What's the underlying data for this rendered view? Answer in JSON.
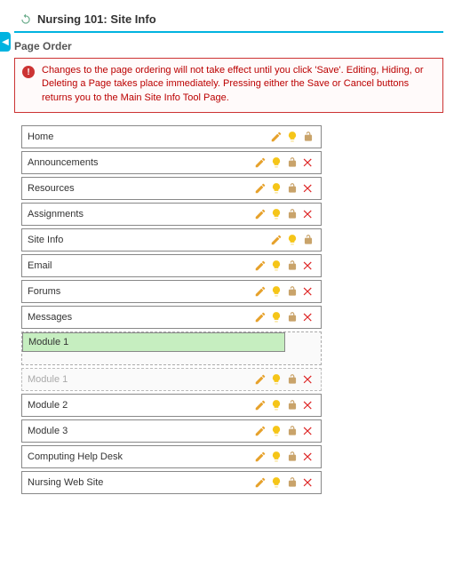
{
  "title": "Nursing 101: Site Info",
  "section": "Page Order",
  "alert": "Changes to the page ordering will not take effect until you click 'Save'. Editing, Hiding, or Deleting a Page takes place immediately. Pressing either the Save or Cancel buttons returns you to the Main Site Info Tool Page.",
  "dragging_label": "Module 1",
  "rows": [
    {
      "label": "Home",
      "deletable": false,
      "ghost": false
    },
    {
      "label": "Announcements",
      "deletable": true,
      "ghost": false
    },
    {
      "label": "Resources",
      "deletable": true,
      "ghost": false
    },
    {
      "label": "Assignments",
      "deletable": true,
      "ghost": false
    },
    {
      "label": "Site Info",
      "deletable": false,
      "ghost": false
    },
    {
      "label": "Email",
      "deletable": true,
      "ghost": false
    },
    {
      "label": "Forums",
      "deletable": true,
      "ghost": false
    },
    {
      "label": "Messages",
      "deletable": true,
      "ghost": false
    },
    {
      "label": "__DROPZONE__",
      "deletable": false,
      "ghost": false
    },
    {
      "label": "Module 1",
      "deletable": true,
      "ghost": true
    },
    {
      "label": "Module 2",
      "deletable": true,
      "ghost": false
    },
    {
      "label": "Module 3",
      "deletable": true,
      "ghost": false
    },
    {
      "label": "Computing Help Desk",
      "deletable": true,
      "ghost": false
    },
    {
      "label": "Nursing Web Site",
      "deletable": true,
      "ghost": false
    }
  ]
}
